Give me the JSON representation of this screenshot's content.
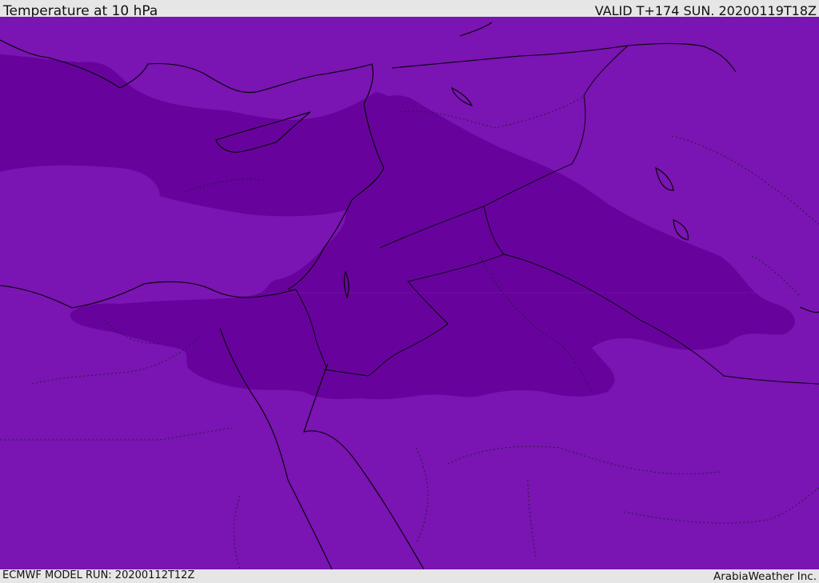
{
  "header": {
    "title": "Temperature at 10 hPa",
    "valid": "VALID T+174 SUN. 20200119T18Z"
  },
  "footer": {
    "model_run": "ECMWF MODEL RUN: 20200112T12Z",
    "brand": "ArabiaWeather Inc."
  },
  "colors": {
    "bar_background": "#e6e6e6",
    "field_light": "#7a14b2",
    "field_dark": "#67039c",
    "coastline": "#000000"
  },
  "map": {
    "region": "Eastern Mediterranean and Middle East",
    "variable": "temperature",
    "level": "10 hPa"
  }
}
